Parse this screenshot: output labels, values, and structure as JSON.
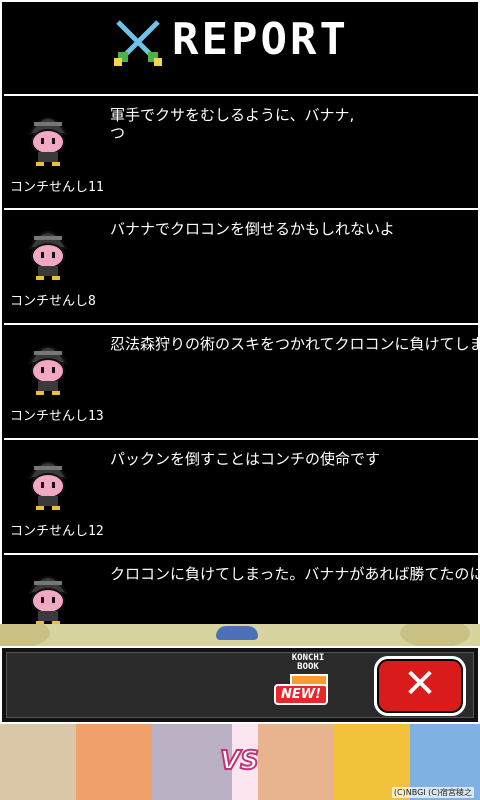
{
  "header": {
    "title": "REPORT",
    "icon": "crossed-swords-icon"
  },
  "reports": [
    {
      "name": "コンチせんし11",
      "message": "軍手でクサをむしるように、バナナ,\nつ"
    },
    {
      "name": "コンチせんし8",
      "message": "バナナでクロコンを倒せるかもしれないよ"
    },
    {
      "name": "コンチせんし13",
      "message": "忍法森狩りの術のスキをつかれてクロコンに負けてしまった"
    },
    {
      "name": "コンチせんし12",
      "message": "パックンを倒すことはコンチの使命です"
    },
    {
      "name": "",
      "message": "クロコンに負けてしまった。バナナがあれば勝てたのに"
    }
  ],
  "bottom": {
    "book_label": "KONCHI\nBOOK",
    "new_badge": "NEW!",
    "close_label": "✕"
  },
  "ad": {
    "vs_text": "VS",
    "copyright": "(C)NBGI (C)宿宮稜之"
  },
  "colors": {
    "close_button": "#d91b1b",
    "new_badge": "#e8262b",
    "avatar_face": "#f2a8c4",
    "helmet": "#3a3a3a"
  }
}
